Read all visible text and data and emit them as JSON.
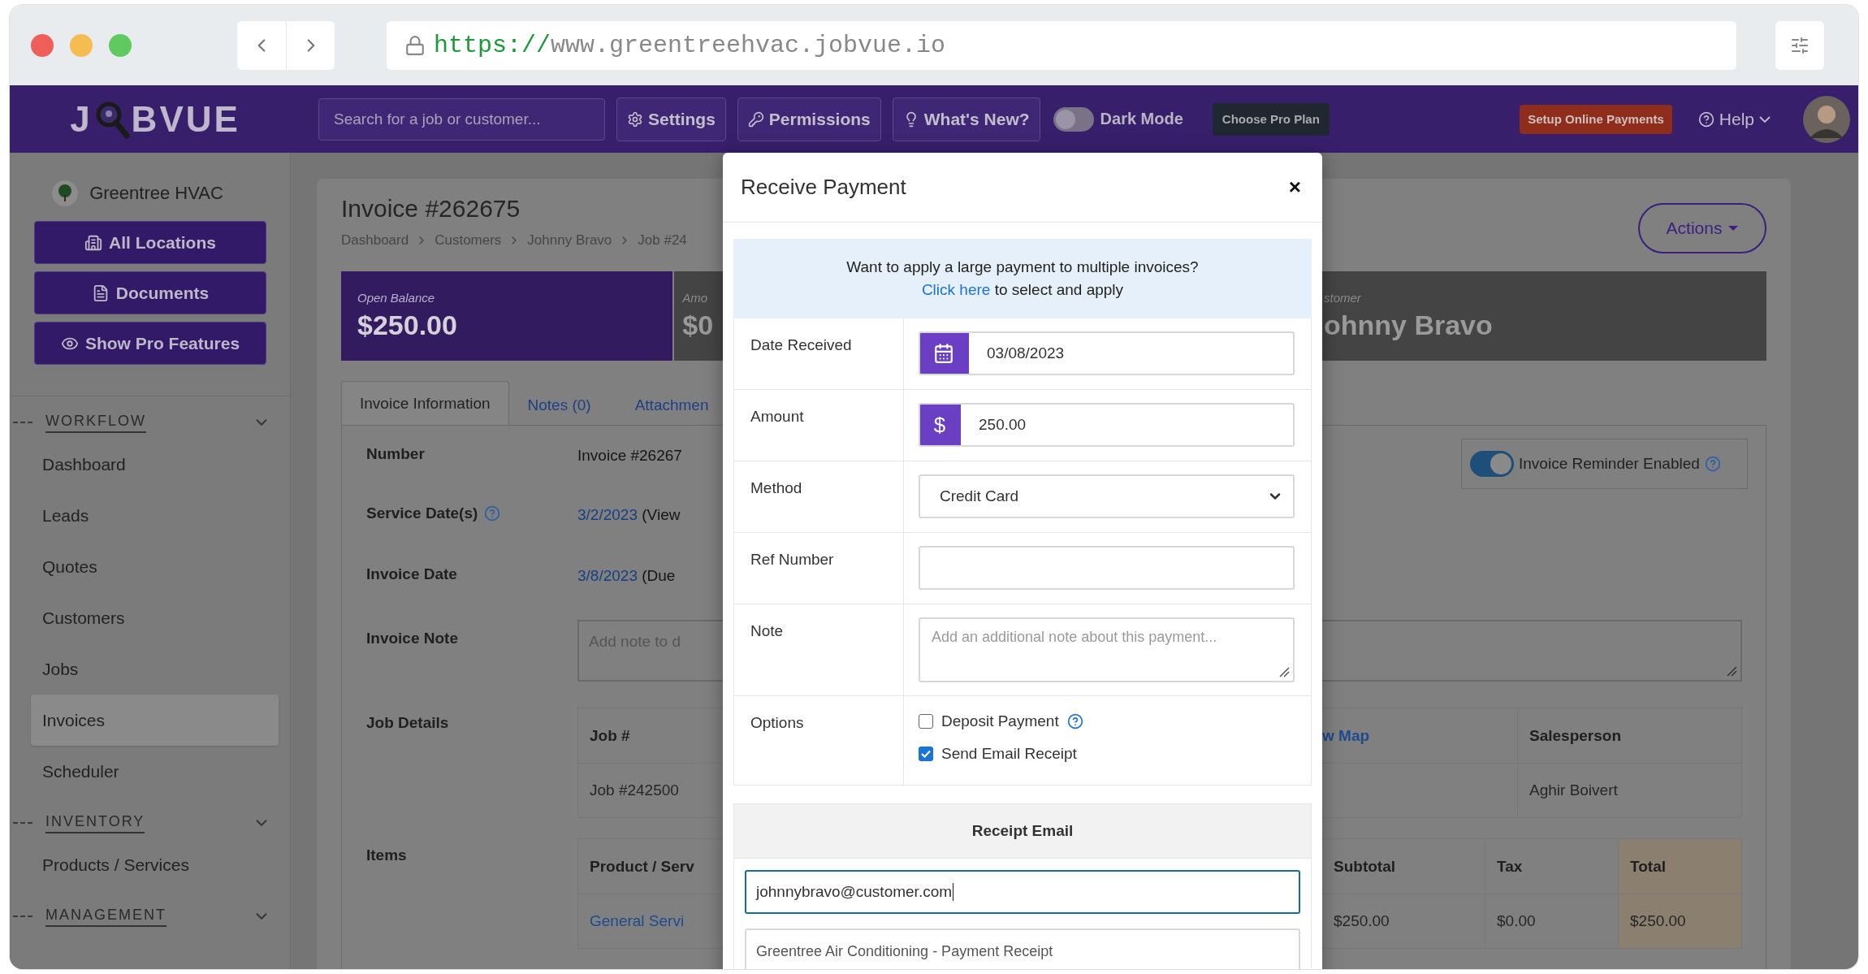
{
  "browser": {
    "url_scheme": "https://",
    "url_host": "www.greentreehvac.jobvue.io"
  },
  "header": {
    "logo": {
      "left": "J",
      "right": "BVUE"
    },
    "search": {
      "placeholder": "Search for a job or customer..."
    },
    "buttons": [
      {
        "label": "Settings",
        "kind": "gear"
      },
      {
        "label": "Permissions",
        "kind": "key"
      },
      {
        "label": "What's New?",
        "kind": "bulb"
      }
    ],
    "dark_mode": {
      "label": "Dark Mode",
      "on": false
    },
    "pro_plan": "Choose Pro Plan",
    "payments_button": "Setup Online Payments",
    "help": "Help"
  },
  "sidebar": {
    "company": "Greentree HVAC",
    "buttons": [
      {
        "label": "All Locations",
        "kind": "building"
      },
      {
        "label": "Documents",
        "kind": "pdf"
      },
      {
        "label": "Show Pro Features",
        "kind": "eye"
      }
    ],
    "sections": [
      {
        "title": "WORKFLOW",
        "expanded": true,
        "items": [
          {
            "label": "Dashboard",
            "selected": false
          },
          {
            "label": "Leads",
            "selected": false
          },
          {
            "label": "Quotes",
            "selected": false
          },
          {
            "label": "Customers",
            "selected": false
          },
          {
            "label": "Jobs",
            "selected": false
          },
          {
            "label": "Invoices",
            "selected": true
          },
          {
            "label": "Scheduler",
            "selected": false
          }
        ]
      },
      {
        "title": "INVENTORY",
        "expanded": true,
        "items": [
          {
            "label": "Products / Services",
            "selected": false
          }
        ]
      },
      {
        "title": "MANAGEMENT",
        "expanded": true
      }
    ]
  },
  "invoice": {
    "title": "Invoice #262675",
    "breadcrumb": [
      "Dashboard",
      "Customers",
      "Johnny Bravo",
      "Job #24"
    ],
    "actions": "Actions",
    "summary": [
      {
        "kind": "balance",
        "label": "Open Balance",
        "value": "$250.00"
      },
      {
        "kind": "amount",
        "label": "Amo",
        "value": "$0"
      },
      {
        "kind": "customer",
        "label": "stomer",
        "value": "ohnny Bravo"
      }
    ],
    "tabs": [
      {
        "label": "Invoice Information",
        "selected": true
      },
      {
        "label": "Notes (0)",
        "selected": false
      },
      {
        "label": "Attachmen",
        "selected": false
      }
    ],
    "fields": [
      {
        "label": "Number",
        "value": "Invoice #26267"
      },
      {
        "label": "Service Date(s)",
        "help": true,
        "link": "3/2/2023",
        "value": "(View"
      },
      {
        "label": "Invoice Date",
        "link": "3/8/2023",
        "value": "(Due"
      }
    ],
    "reminder": {
      "label": "Invoice Reminder Enabled",
      "on": true
    },
    "note": {
      "label": "Invoice Note",
      "placeholder": "Add note to d"
    },
    "job_details": {
      "label": "Job Details",
      "job_header": "Job #",
      "job_value": "Job #242500",
      "map_link": "w Map",
      "salesperson_header": "Salesperson",
      "salesperson": "Aghir Boivert"
    },
    "items": {
      "label": "Items",
      "product_header": "Product / Serv",
      "product": "General Servi",
      "columns": [
        {
          "header": "Subtotal",
          "value": "$250.00",
          "highlight": false
        },
        {
          "header": "Tax",
          "value": "$0.00",
          "highlight": false
        },
        {
          "header": "Total",
          "value": "$250.00",
          "highlight": true
        }
      ]
    }
  },
  "modal": {
    "title": "Receive Payment",
    "close": "×",
    "notice": {
      "question": "Want to apply a large payment to multiple invoices?",
      "link": "Click here",
      "rest": "to select and apply"
    },
    "fields": [
      {
        "label": "Date Received",
        "kind": "date",
        "value": "03/08/2023"
      },
      {
        "label": "Amount",
        "kind": "money",
        "addon": "$",
        "value": "250.00"
      },
      {
        "label": "Method",
        "kind": "select",
        "value": "Credit Card"
      },
      {
        "label": "Ref Number",
        "kind": "text"
      },
      {
        "label": "Note",
        "kind": "textarea",
        "placeholder": "Add an additional note about this payment..."
      },
      {
        "label": "Options",
        "kind": "options",
        "options": [
          {
            "label": "Deposit Payment",
            "checked": false,
            "help": true
          },
          {
            "label": "Send Email Receipt",
            "checked": true
          }
        ]
      }
    ],
    "receipt": {
      "title": "Receipt Email",
      "email": "johnnybravo@customer.com",
      "subject": "Greentree Air Conditioning - Payment Receipt"
    }
  }
}
